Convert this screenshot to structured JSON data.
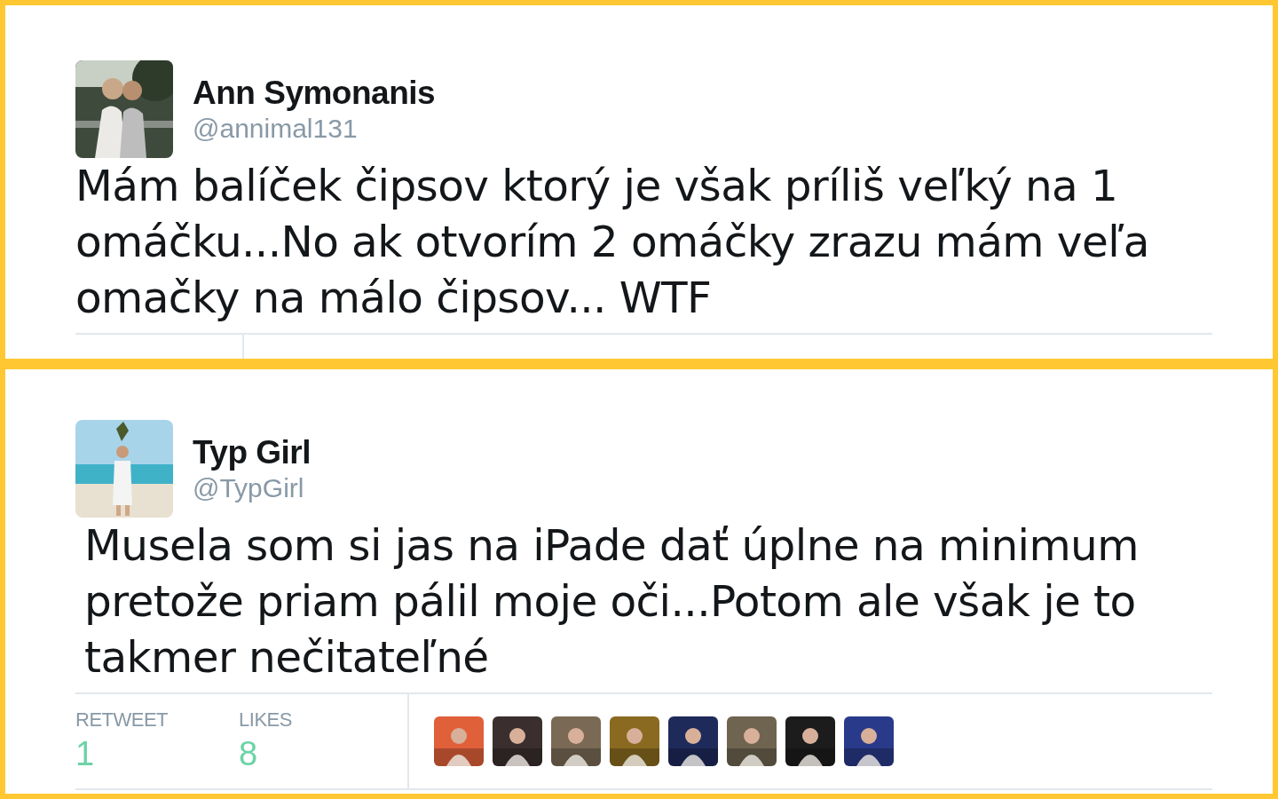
{
  "tweets": [
    {
      "name": "Ann Symonanis",
      "handle": "@annimal131",
      "text": "Mám balíček čipsov ktorý je však príliš veľký na 1 omáčku...No ak otvorím 2 omáčky zrazu mám veľa omačky na málo čipsov... WTF"
    },
    {
      "name": "Typ Girl",
      "handle": "@TypGirl",
      "text": "Musela som si jas na iPade dať úplne na minimum pretože priam pálil moje oči...Potom ale však je to takmer nečitateľné",
      "stats": [
        {
          "label": "RETWEET",
          "value": "1"
        },
        {
          "label": "LIKES",
          "value": "8"
        }
      ]
    }
  ]
}
